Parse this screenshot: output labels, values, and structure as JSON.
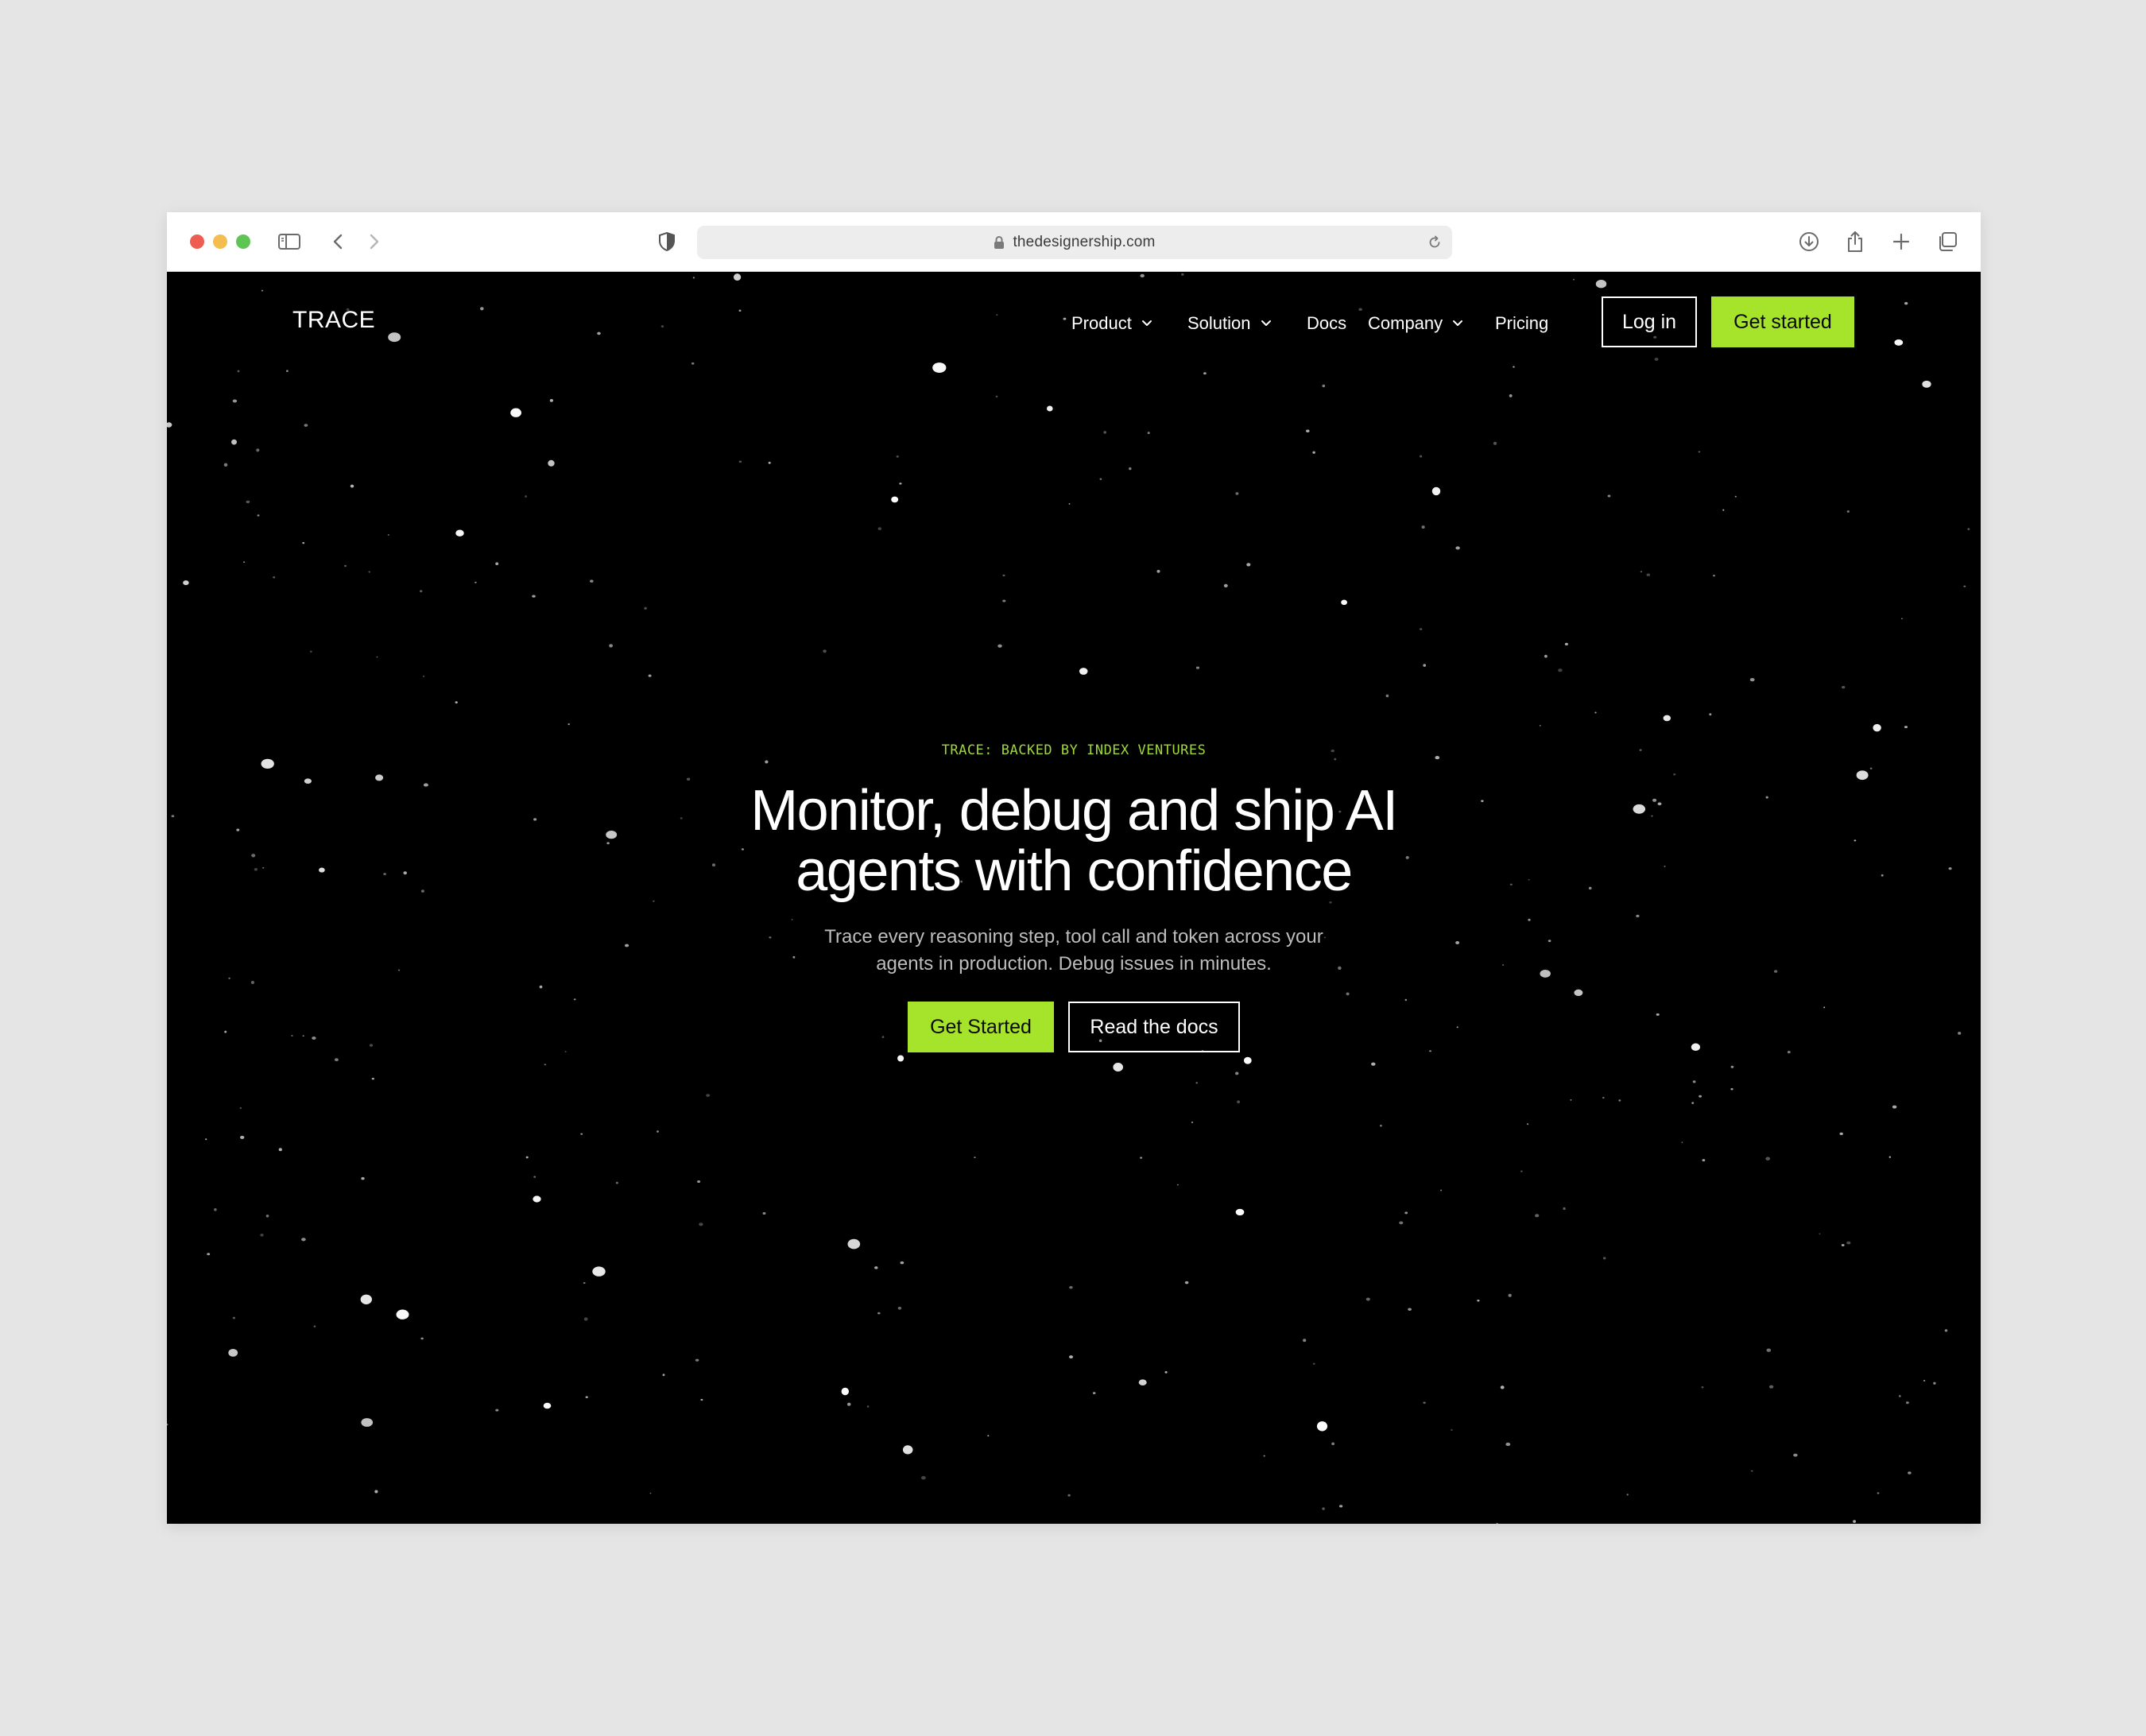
{
  "browser": {
    "url": "thedesignership.com"
  },
  "site": {
    "logo": "TRACE",
    "nav": {
      "product": "Product",
      "solution": "Solution",
      "docs": "Docs",
      "company": "Company",
      "pricing": "Pricing"
    },
    "login_label": "Log in",
    "get_started_label": "Get started"
  },
  "hero": {
    "eyebrow": "TRACE: BACKED BY INDEX VENTURES",
    "headline_line1": "Monitor, debug and ship AI",
    "headline_line2": "agents with confidence",
    "subhead_line1": "Trace every reasoning step, tool call and token across your",
    "subhead_line2": "agents in production. Debug issues in minutes.",
    "primary_cta": "Get Started",
    "secondary_cta": "Read the docs"
  },
  "colors": {
    "accent": "#a6e32b",
    "background": "#000000",
    "eyebrow": "#9fd83a"
  },
  "icons": [
    "sidebar-icon",
    "back-icon",
    "forward-icon",
    "shield-icon",
    "lock-icon",
    "reload-icon",
    "download-icon",
    "share-icon",
    "new-tab-icon",
    "tabs-overview-icon",
    "chevron-down-icon"
  ]
}
